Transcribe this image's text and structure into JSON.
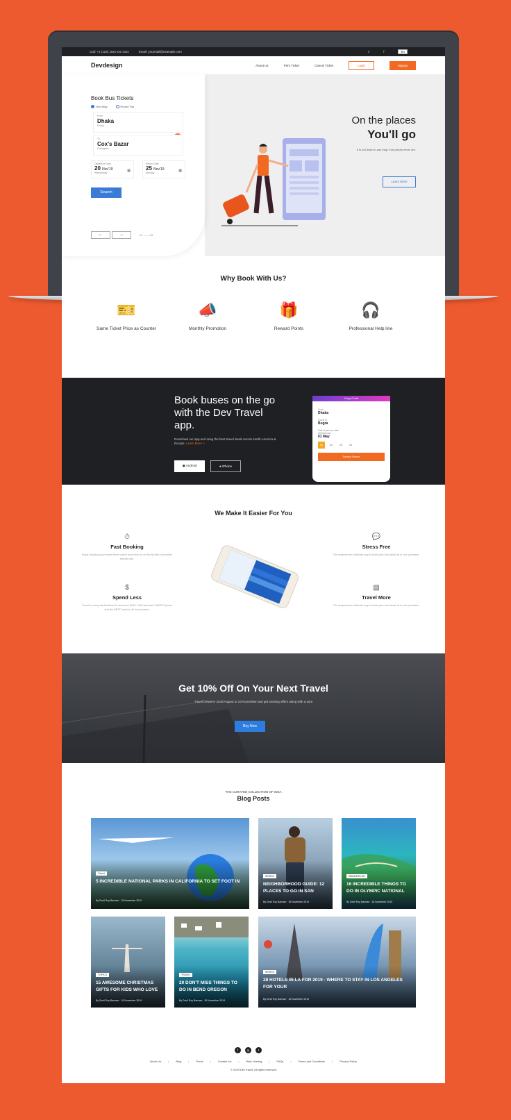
{
  "topbar": {
    "call": "Call: +1 (123) 10xx-xxx-xxxx",
    "email": "Email: yourmail@example.com",
    "lang": "En"
  },
  "nav": {
    "logo": "Devdesign",
    "links": [
      "About Us",
      "Print Ticket",
      "Cancel Ticket"
    ],
    "login": "Login",
    "signup": "Signup"
  },
  "booking": {
    "title": "Book Bus Tickets",
    "trip_types": [
      "One Way",
      "Round Trip"
    ],
    "from": {
      "label": "From",
      "value": "Dhaka",
      "sub": "Dhaka"
    },
    "to": {
      "label": "To",
      "value": "Cox's Bazar",
      "sub": "Chittagram"
    },
    "departure": {
      "label": "Departure Date",
      "day": "20",
      "month": "Nov'19",
      "weekday": "Wednesday"
    },
    "return": {
      "label": "Return Date",
      "day": "25",
      "month": "Nov'19",
      "weekday": "Monday"
    },
    "search": "Search",
    "pager": "01 —— 04"
  },
  "hero": {
    "title1": "On the places",
    "title2": "You'll go",
    "desc": "It is not down in any map; true places never are.",
    "cta": "Learn More"
  },
  "why": {
    "title": "Why Book With Us?",
    "items": [
      {
        "label": "Same Ticket Price as Counter",
        "icon": "ticket-icon"
      },
      {
        "label": "Monthly Promotion",
        "icon": "megaphone-icon"
      },
      {
        "label": "Reward Points",
        "icon": "gift-icon"
      },
      {
        "label": "Professional Help line",
        "icon": "support-agent-icon"
      }
    ]
  },
  "app": {
    "title": "Book buses on the go with the Dev Travel app.",
    "desc": "Download our app and snag the best travel deals across North America & Europe.",
    "learn": "Learn More >",
    "android": "Android",
    "iphone": "iPhone",
    "phone": {
      "header": "Copy Code",
      "from_label": "From",
      "from": "Dhaka",
      "to_label": "Going to",
      "to": "Bogra",
      "date_label": "Select journey date",
      "weekday": "Wednesday",
      "date": "01 May",
      "days": [
        "01",
        "02",
        "03",
        "04"
      ],
      "button": "Search Buses"
    }
  },
  "easier": {
    "title": "We Make It Easier For You",
    "items": [
      {
        "title": "Fast Booking",
        "desc": "Enjoy enjoying your travel times online from here on on the fly with our mobile friendly site."
      },
      {
        "title": "Stress Free",
        "desc": "The simplest and ultimate way to book your bus travel all in one purchase."
      },
      {
        "title": "Spend Less",
        "desc": "Travel to many destinations for less than $150*. We have the LOWEST prices and the BEST service, all in one place."
      },
      {
        "title": "Travel More",
        "desc": "The simplest and ultimate way to book your bus travel all in one purchase."
      }
    ]
  },
  "promo": {
    "title": "Get 10% Off On Your Next Travel",
    "desc": "Travel between 22nd August to 23 November and get exciting offers along with a sure",
    "cta": "Buy Now"
  },
  "blog": {
    "kicker": "THE CURATED COLLECTION OF IDEA",
    "title": "Blog Posts",
    "posts": [
      {
        "tag": "Travel",
        "title": "5 Incredible National Parks in California to Set Foot In",
        "by": "By Devil Roy Barman · 18 November 2019"
      },
      {
        "tag": "WORLD",
        "title": "Neighborhood Guide: 12 Places to Go in San",
        "by": "By Devil Roy Barman · 18 November 2019"
      },
      {
        "tag": "WANDERLUST",
        "title": "16 Incredible Things to Do in Olympic National",
        "by": "By Devil Roy Barman · 18 November 2019"
      },
      {
        "tag": "TOPICS",
        "title": "15 Awesome Christmas Gifts for Kids Who Love",
        "by": "By Devil Roy Barman · 18 November 2019"
      },
      {
        "tag": "TRAVEL",
        "title": "20 Don't Miss Things to Do in Bend Oregon",
        "by": "By Devil Roy Barman · 18 November 2019"
      },
      {
        "tag": "WORLD",
        "title": "28 Hotels in LA for 2019 - Where to Stay in Los Angeles for Your",
        "by": "By Devil Roy Barman · 18 November 2019"
      }
    ]
  },
  "footer": {
    "links": [
      "About Us",
      "Blog",
      "Press",
      "Contact Us",
      "Web Hosting",
      "FAQs",
      "Terms and Conditions",
      "Privacy Policy"
    ],
    "copyright": "© 2019 Dev travel. All rights reserved"
  }
}
